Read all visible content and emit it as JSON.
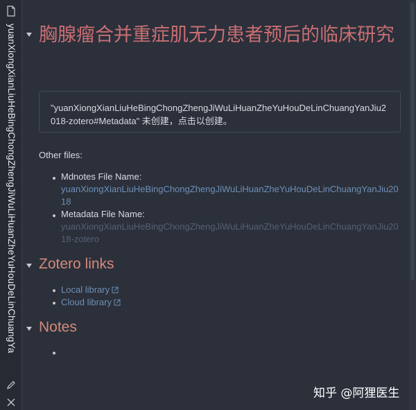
{
  "sidebar": {
    "tab_title": "yuanXiongXianLiuHeBingChongZhengJiWuLiHuanZheYuHouDeLinChuangYa"
  },
  "main": {
    "title": "胸腺瘤合并重症肌无力患者预后的临床研究",
    "callout": "\"yuanXiongXianLiuHeBingChongZhengJiWuLiHuanZheYuHouDeLinChuangYanJiu2018-zotero#Metadata\" 未创建，点击以创建。",
    "other_files": {
      "label": "Other files:",
      "items": [
        {
          "label": "Mdnotes File Name:",
          "value": "yuanXiongXianLiuHeBingChongZhengJiWuLiHuanZheYuHouDeLinChuangYanJiu2018"
        },
        {
          "label": "Metadata File Name:",
          "value": "yuanXiongXianLiuHeBingChongZhengJiWuLiHuanZheYuHouDeLinChuangYanJiu2018-zotero"
        }
      ]
    },
    "zotero_links": {
      "heading": "Zotero links",
      "links": [
        {
          "label": "Local library",
          "icon": "external-link-icon"
        },
        {
          "label": "Cloud library",
          "icon": "external-link-icon"
        }
      ]
    },
    "notes": {
      "heading": "Notes"
    }
  },
  "watermark": "知乎 @阿狸医生",
  "colors": {
    "background": "#2b303b",
    "title": "#c96e72",
    "heading": "#d58a7a",
    "link": "#6f8fb6",
    "dim_link": "#566072",
    "text": "#d7dbe2"
  }
}
